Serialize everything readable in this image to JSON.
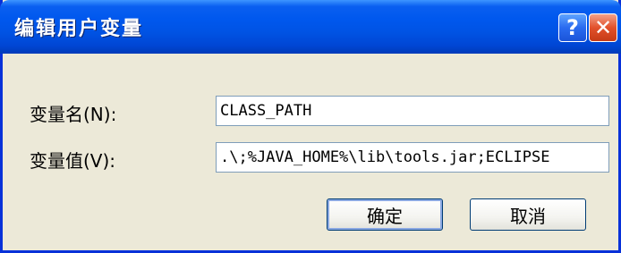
{
  "window": {
    "title": "编辑用户变量"
  },
  "titlebar": {
    "help_label": "?",
    "close_label": "✕"
  },
  "form": {
    "name_label": "变量名(N):",
    "name_value": "CLASS_PATH",
    "value_label": "变量值(V):",
    "value_value": ".\\;%JAVA_HOME%\\lib\\tools.jar;ECLIPSE"
  },
  "buttons": {
    "ok_label": "确定",
    "cancel_label": "取消"
  },
  "colors": {
    "titlebar": "#0058ee",
    "frame": "#0831d9",
    "close": "#e2512b",
    "dialog_bg": "#ece9d8"
  },
  "icons": {
    "help": "help-icon",
    "close": "close-icon"
  }
}
